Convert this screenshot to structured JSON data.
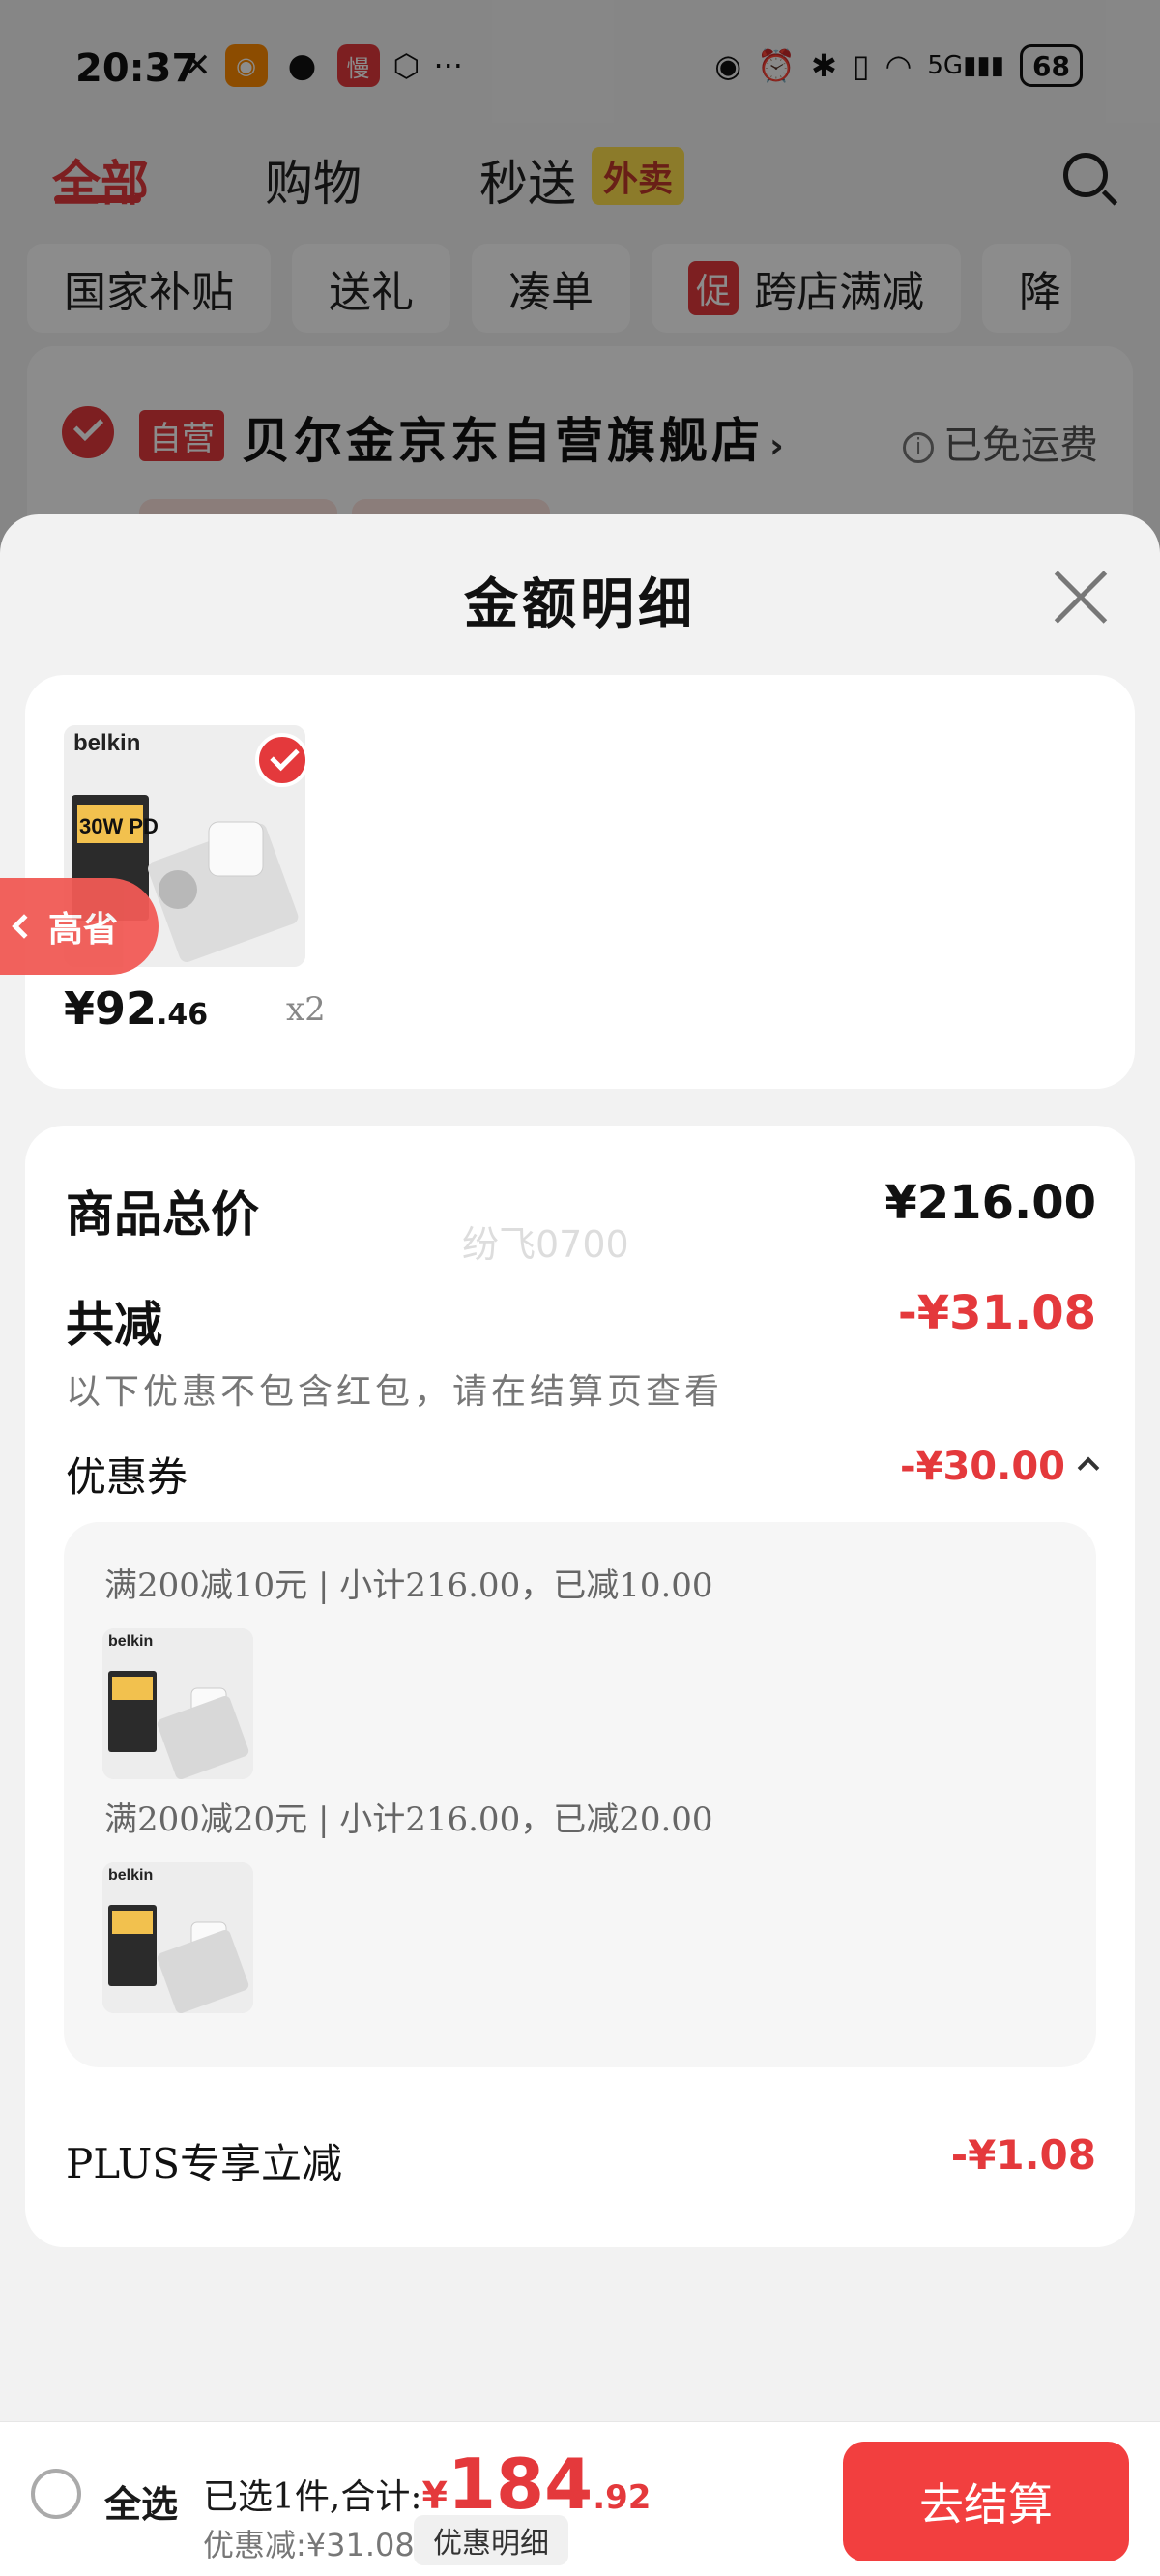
{
  "status_bar": {
    "time": "20:37",
    "battery": "68",
    "network": "5G"
  },
  "top_tabs": {
    "all": "全部",
    "shopping": "购物",
    "express": "秒送",
    "waimai": "外卖"
  },
  "chips": [
    "国家补贴",
    "送礼",
    "凑单",
    "跨店满减",
    "降"
  ],
  "chip_promo_tag": "促",
  "store": {
    "badge": "自营",
    "name": "贝尔金京东自营旗舰店",
    "arrow": "›",
    "shipping": "已免运费"
  },
  "sheet": {
    "title": "金额明细"
  },
  "product": {
    "brand": "belkin",
    "badge_text": "30W PD",
    "price_int": "¥92",
    "price_dec": ".46",
    "quantity": "x2"
  },
  "gaosheng_label": "高省",
  "watermark": "纷飞0700",
  "details": {
    "total_label": "商品总价",
    "total_value": "¥216.00",
    "reduce_label": "共减",
    "reduce_value": "-¥31.08",
    "note": "以下优惠不包含红包，请在结算页查看",
    "coupon_label": "优惠券",
    "coupon_value": "-¥30.00",
    "coupons": [
      {
        "text": "满200减10元 | 小计216.00，已减10.00"
      },
      {
        "text": "满200减20元 | 小计216.00，已减20.00"
      }
    ],
    "plus_label": "PLUS专享立减",
    "plus_value": "-¥1.08"
  },
  "bottom_bar": {
    "select_all": "全选",
    "summary_prefix": "已选1件,合计:",
    "currency": "¥",
    "amount_int": "184",
    "amount_dec": ".92",
    "discount": "优惠减:¥31.08",
    "detail_button": "优惠明细",
    "checkout_button": "去结算"
  },
  "colors": {
    "accent": "#e4393c",
    "checkout": "#f23f3f",
    "waimai_bg": "#ffe14d"
  },
  "icons": [
    "close-icon",
    "check-icon",
    "search-icon",
    "chevron-up-icon",
    "chevron-left-icon",
    "info-icon",
    "wifi-icon",
    "bluetooth-icon",
    "eye-icon",
    "alarm-icon"
  ]
}
